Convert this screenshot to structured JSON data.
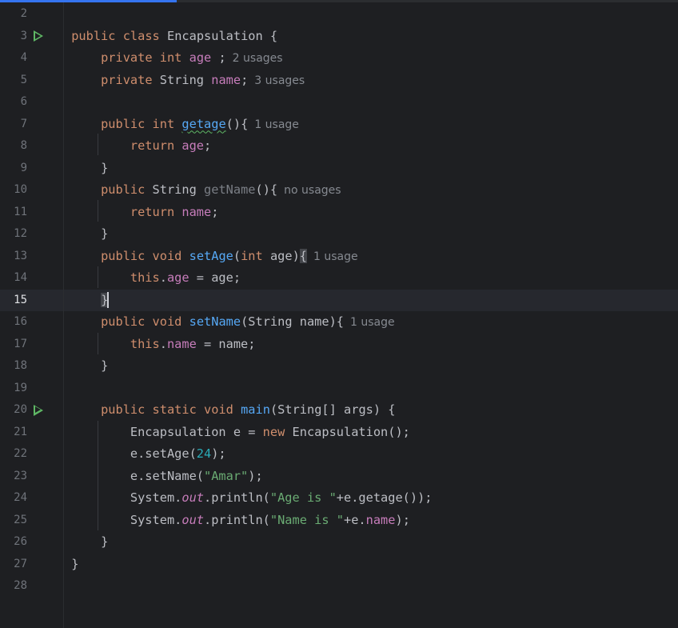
{
  "colors": {
    "background": "#1e1f22",
    "keyword": "#cf8e6d",
    "field": "#c77dbb",
    "method": "#56a8f5",
    "string": "#6aab73",
    "number": "#2aacb8",
    "run_icon": "#5fb865",
    "hint": "#868a91"
  },
  "gutter": {
    "line_numbers": [
      "2",
      "3",
      "4",
      "5",
      "6",
      "7",
      "8",
      "9",
      "10",
      "11",
      "12",
      "13",
      "14",
      "15",
      "16",
      "17",
      "18",
      "19",
      "20",
      "21",
      "22",
      "23",
      "24",
      "25",
      "26",
      "27",
      "28"
    ],
    "run_icon_lines": [
      "3",
      "20"
    ],
    "current_line": "15"
  },
  "editor": {
    "code": {
      "class_decl": {
        "kw_public": "public",
        "kw_class": "class",
        "name": "Encapsulation",
        "brace": " {"
      },
      "field_age": {
        "kw_private": "private",
        "type": "int",
        "name": "age",
        "rest": " ;",
        "hint": "2 usages"
      },
      "field_name": {
        "kw_private": "private",
        "type": "String",
        "name": "name",
        "rest": ";",
        "hint": "3 usages"
      },
      "getage": {
        "kw_public": "public",
        "type": "int",
        "name": "getage",
        "rest": "(){",
        "hint": "1 usage"
      },
      "getage_return": {
        "kw_return": "return",
        "value": "age",
        "rest": ";"
      },
      "close1": "}",
      "getname": {
        "kw_public": "public",
        "type": "String",
        "name": "getName",
        "rest": "(){",
        "hint": "no usages"
      },
      "getname_return": {
        "kw_return": "return",
        "value": "name",
        "rest": ";"
      },
      "close2": "}",
      "setage": {
        "kw_public": "public",
        "kw_void": "void",
        "name": "setAge",
        "params_open": "(",
        "param_type": "int",
        "param_name": " age)",
        "brace": "{",
        "hint": "1 usage"
      },
      "setage_body": {
        "kw_this": "this",
        "dot": ".",
        "field": "age",
        "rest": " = age;"
      },
      "close3": "}",
      "setname": {
        "kw_public": "public",
        "kw_void": "void",
        "name": "setName",
        "params": "(String name){",
        "hint": "1 usage"
      },
      "setname_body": {
        "kw_this": "this",
        "dot": ".",
        "field": "name",
        "rest": " = name;"
      },
      "close4": "}",
      "main": {
        "kw_public": "public",
        "kw_static": "static",
        "kw_void": "void",
        "name": "main",
        "params": "(String[] args) {"
      },
      "main_new": {
        "pre": "Encapsulation e = ",
        "kw_new": "new",
        "post": " Encapsulation();"
      },
      "main_setage": {
        "pre": "e.setAge(",
        "num": "24",
        "post": ");"
      },
      "main_setname": {
        "pre": "e.setName(",
        "str": "\"Amar\"",
        "post": ");"
      },
      "main_println1": {
        "pre": "System.",
        "out": "out",
        "mid": ".println(",
        "str": "\"Age is \"",
        "post": "+e.getage());"
      },
      "main_println2": {
        "pre": "System.",
        "out": "out",
        "mid": ".println(",
        "str": "\"Name is \"",
        "plus": "+e.",
        "field": "name",
        "post": ");"
      },
      "close5": "}",
      "close_class": "}"
    }
  }
}
